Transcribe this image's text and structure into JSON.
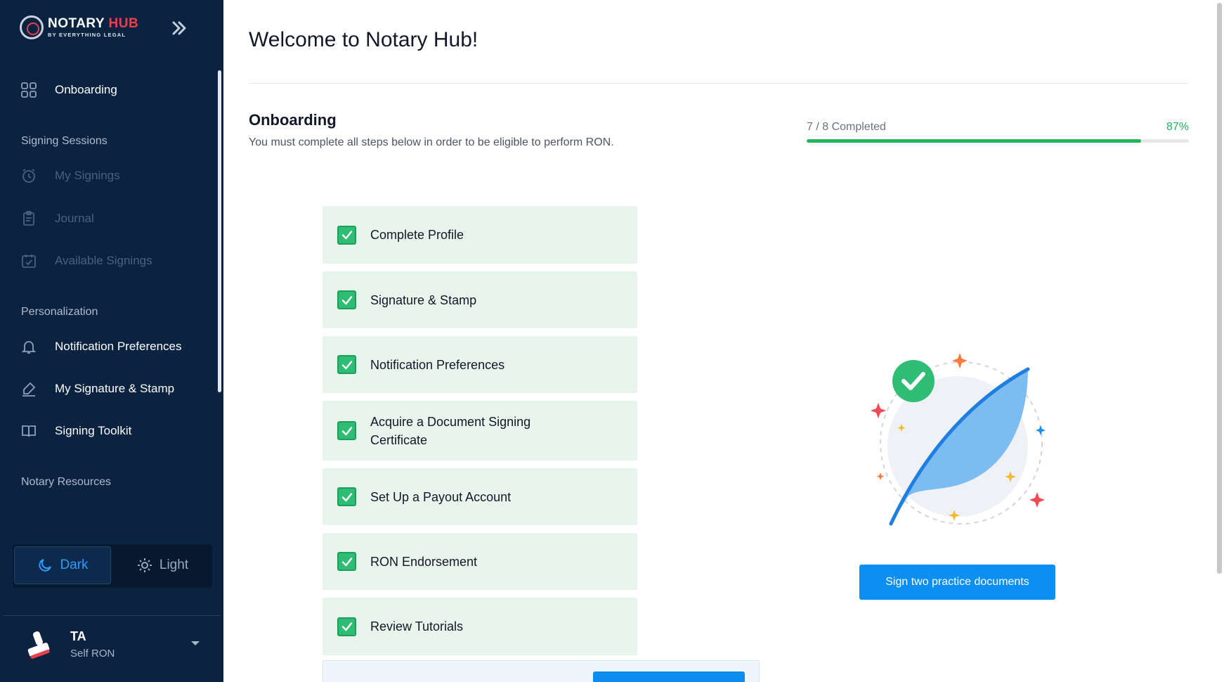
{
  "brand": {
    "name_part1": "NOTARY",
    "name_part2": "HUB",
    "subtitle": "BY EVERYTHING LEGAL"
  },
  "sidebar": {
    "onboarding_label": "Onboarding",
    "section_signing": "Signing Sessions",
    "my_signings": "My Signings",
    "journal": "Journal",
    "available_signings": "Available Signings",
    "section_personalization": "Personalization",
    "notification_preferences": "Notification Preferences",
    "signature_stamp": "My Signature & Stamp",
    "signing_toolkit": "Signing Toolkit",
    "section_resources": "Notary Resources"
  },
  "theme": {
    "dark_label": "Dark",
    "light_label": "Light",
    "selected": "Dark"
  },
  "user": {
    "initials": "TA",
    "role": "Self RON"
  },
  "main": {
    "title": "Welcome to Notary Hub!",
    "section_title": "Onboarding",
    "section_desc": "You must complete all steps below in order to be eligible to perform RON.",
    "progress_label": "7 / 8 Completed",
    "progress_pct": "87%",
    "progress_fraction": 0.875,
    "steps": [
      {
        "label": "Complete Profile",
        "done": true
      },
      {
        "label": "Signature & Stamp",
        "done": true
      },
      {
        "label": "Notification Preferences",
        "done": true
      },
      {
        "label": "Acquire a Document Signing Certificate",
        "done": true
      },
      {
        "label": "Set Up a Payout Account",
        "done": true
      },
      {
        "label": "RON Endorsement",
        "done": true
      },
      {
        "label": "Review Tutorials",
        "done": true
      }
    ],
    "cta_label": "Sign two practice documents"
  },
  "colors": {
    "sidebar_bg": "#0b2341",
    "accent_blue": "#0b8ff2",
    "success_green": "#22b55b",
    "step_bg": "#e8f5ec",
    "brand_red": "#e8414c"
  },
  "icons": [
    "onboarding-grid-icon",
    "alarm-clock-icon",
    "clipboard-icon",
    "calendar-check-icon",
    "bell-icon",
    "pen-signature-icon",
    "book-icon",
    "moon-icon",
    "sun-icon",
    "stamp-avatar-icon",
    "double-chevron-right-icon",
    "checkmark-icon",
    "feather-illustration"
  ]
}
